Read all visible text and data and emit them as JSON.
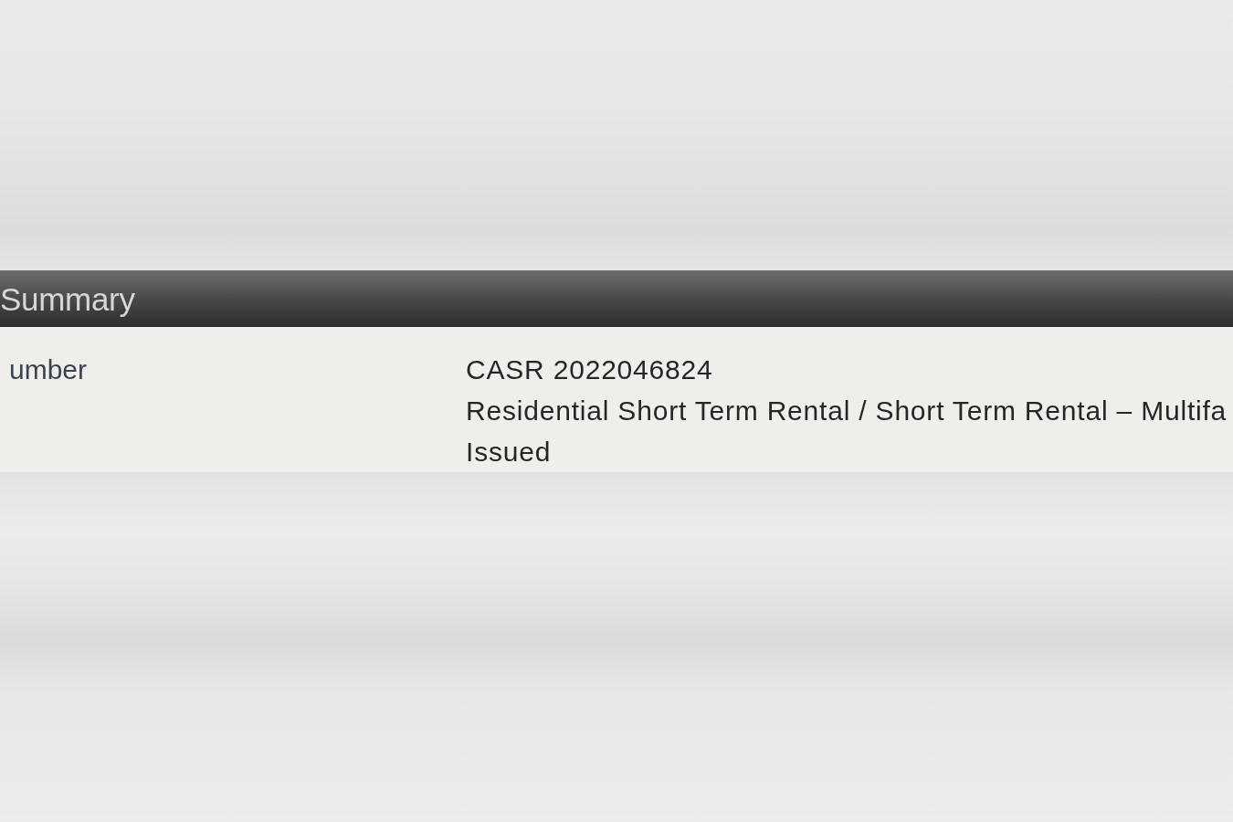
{
  "section": {
    "title": "Summary"
  },
  "fields": [
    {
      "label": "umber",
      "value": "CASR 2022046824"
    },
    {
      "value": "Residential Short Term Rental / Short Term Rental – Multifa"
    },
    {
      "value": "Issued"
    }
  ]
}
